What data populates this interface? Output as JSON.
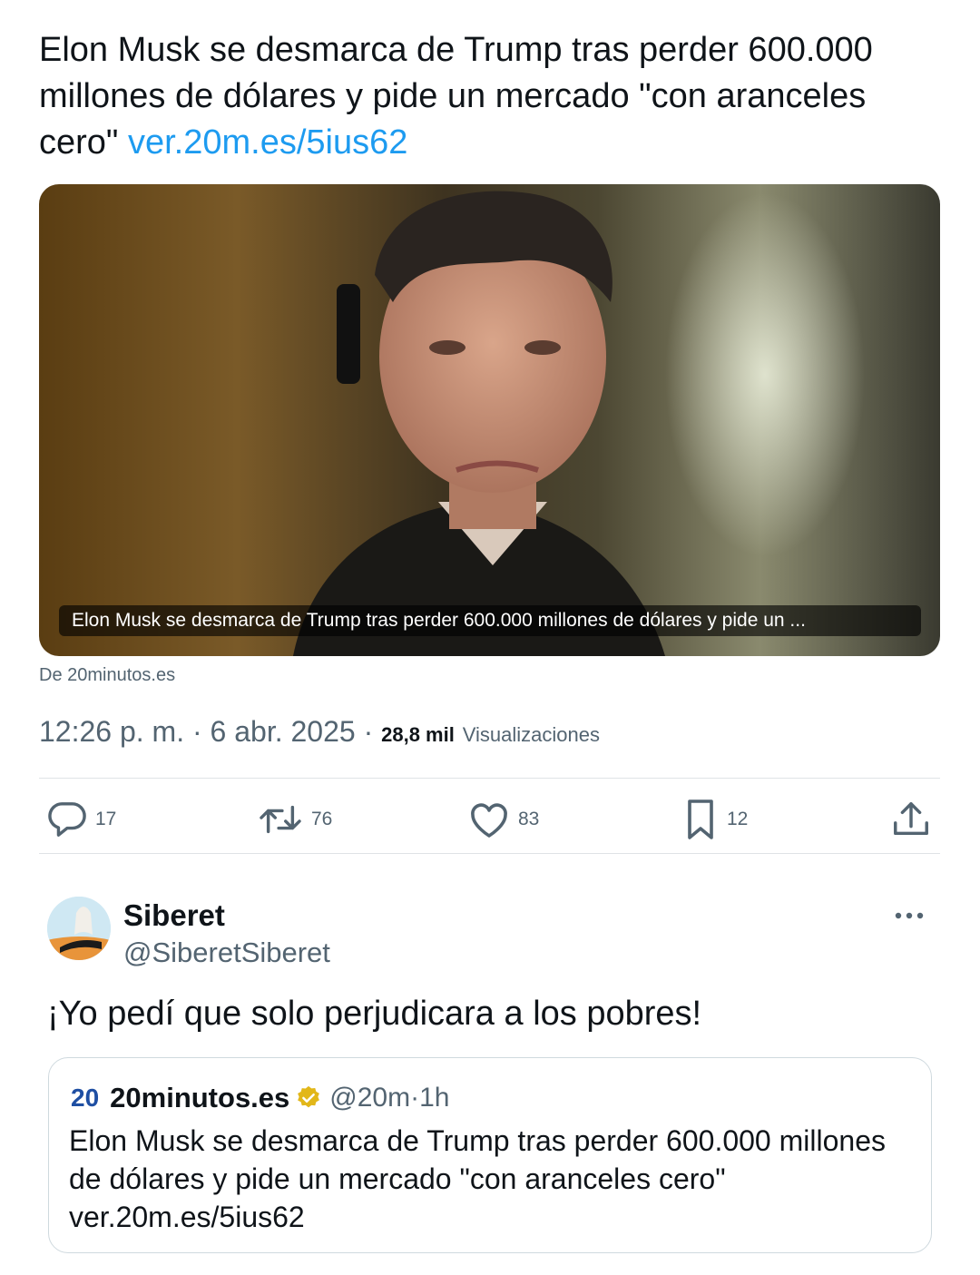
{
  "tweet": {
    "text": "Elon Musk se desmarca de Trump tras perder 600.000 millones de dólares y pide un mercado \"con aranceles cero\"",
    "link": "ver.20m.es/5ius62",
    "media_caption": "Elon Musk se desmarca de Trump tras perder 600.000 millones de dólares y pide un ...",
    "source": "De 20minutos.es",
    "time": "12:26 p. m.",
    "date": "6 abr. 2025",
    "views_count": "28,8 mil",
    "views_label": "Visualizaciones",
    "actions": {
      "replies": "17",
      "retweets": "76",
      "likes": "83",
      "bookmarks": "12"
    }
  },
  "reply": {
    "name": "Siberet",
    "handle": "@SiberetSiberet",
    "text": "¡Yo pedí que solo perjudicara a los pobres!"
  },
  "quote": {
    "logo": "20",
    "name": "20minutos.es",
    "handle": "@20m",
    "time": "1h",
    "text": "Elon Musk se desmarca de Trump tras perder 600.000 millones de dólares y pide un mercado \"con aranceles cero\" ver.20m.es/5ius62"
  },
  "colors": {
    "link": "#1d9bf0",
    "secondary_text": "#536471",
    "verified_badge": "#e2b719"
  },
  "icons": [
    "reply-icon",
    "retweet-icon",
    "like-icon",
    "bookmark-icon",
    "share-icon",
    "more-icon",
    "verified-badge-icon"
  ]
}
